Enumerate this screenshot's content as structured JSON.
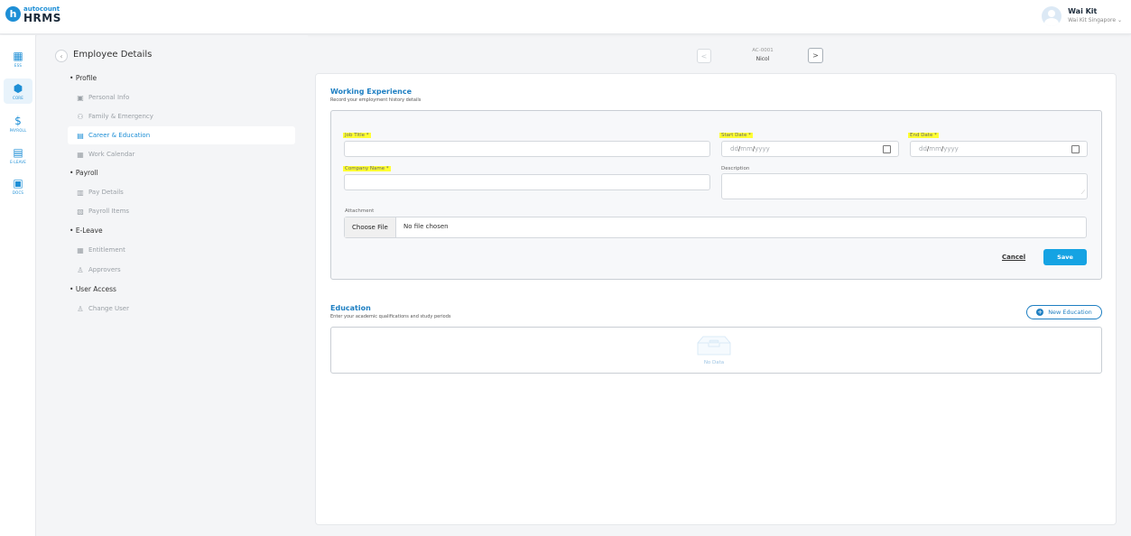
{
  "brand": {
    "logo_letter": "h",
    "logo_top": "autocount",
    "logo_bottom": "HRMS"
  },
  "user": {
    "name": "Wai Kit",
    "org": "Wai Kit Singapore ⌄"
  },
  "rail": [
    {
      "label": "ESS",
      "icon": "▦"
    },
    {
      "label": "CORE",
      "icon": "⬢"
    },
    {
      "label": "PAYROLL",
      "icon": "$"
    },
    {
      "label": "E-LEAVE",
      "icon": "▤"
    },
    {
      "label": "DOCS",
      "icon": "▣"
    }
  ],
  "subnav": {
    "title": "Employee Details",
    "sections": {
      "profile": "Profile",
      "payroll": "Payroll",
      "eleave": "E-Leave",
      "access": "User Access"
    },
    "items": {
      "personal": "Personal Info",
      "family": "Family & Emergency",
      "career": "Career & Education",
      "calendar": "Work Calendar",
      "paydetails": "Pay Details",
      "payitems": "Payroll Items",
      "entitlement": "Entitlement",
      "approvers": "Approvers",
      "changeuser": "Change User"
    }
  },
  "record": {
    "code": "AC-0001",
    "name": "Nicol"
  },
  "working": {
    "title": "Working Experience",
    "subtitle": "Record your employment history details",
    "job_title_label": "Job Title *",
    "start_date_label": "Start Date *",
    "end_date_label": "End Date *",
    "company_label": "Company Name *",
    "description_label": "Description",
    "attachment_label": "Attachment",
    "date_placeholder": {
      "dd": "dd",
      "mm": "mm",
      "yyyy": "yyyy"
    },
    "choose_file": "Choose File",
    "file_status": "No file chosen",
    "cancel": "Cancel",
    "save": "Save"
  },
  "education": {
    "title": "Education",
    "subtitle": "Enter your academic qualifications and study periods",
    "new_button": "New Education",
    "no_data": "No Data"
  },
  "colors": {
    "accent": "#1e8fd6",
    "highlight": "#ffff33",
    "save": "#15a3e3"
  }
}
